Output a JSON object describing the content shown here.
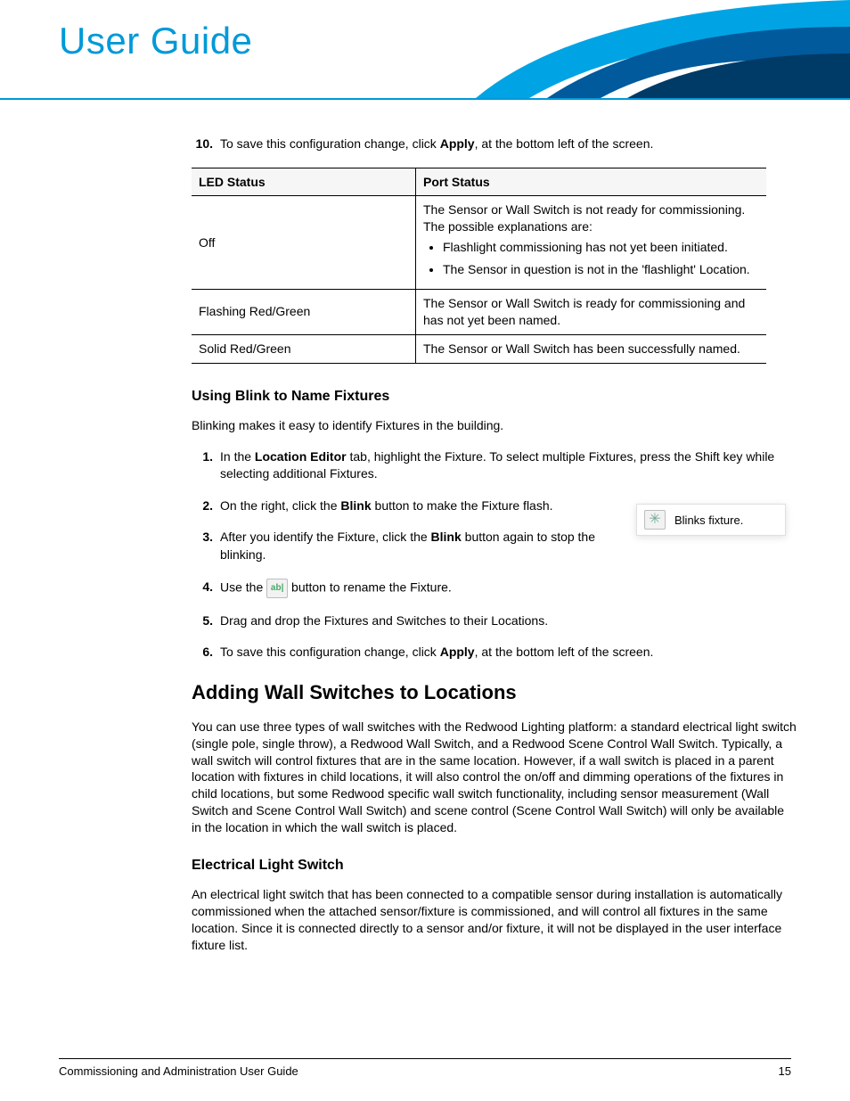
{
  "header": {
    "title": "User Guide"
  },
  "intro_step": {
    "num": "10.",
    "pre": "To save this configuration change, click ",
    "bold": "Apply",
    "post": ", at the bottom left of the screen."
  },
  "table": {
    "h1": "LED Status",
    "h2": "Port Status",
    "rows": [
      {
        "led": "Off",
        "lead": "The Sensor or Wall Switch is not ready for commissioning. The possible explanations are:",
        "bullets": [
          "Flashlight commissioning has not yet been initiated.",
          "The Sensor in question is not in the 'flashlight' Location."
        ]
      },
      {
        "led": "Flashing Red/Green",
        "text": "The Sensor or Wall Switch is ready for commissioning and has not yet been named."
      },
      {
        "led": "Solid Red/Green",
        "text": "The Sensor or Wall Switch has been successfully named."
      }
    ]
  },
  "sec1": {
    "title": "Using Blink to Name Fixtures",
    "intro": "Blinking makes it easy to identify Fixtures in the building.",
    "steps": [
      {
        "num": "1.",
        "pre": "In the ",
        "bold": "Location Editor",
        "post": " tab, highlight the Fixture. To select multiple Fixtures, press the Shift key while selecting additional Fixtures."
      },
      {
        "num": "2.",
        "pre": "On the right, click the ",
        "bold": "Blink",
        "post": " button to make the Fixture flash."
      },
      {
        "num": "3.",
        "pre": "After you identify the Fixture, click the ",
        "bold": "Blink",
        "post": " button again to stop the blinking."
      },
      {
        "num": "4.",
        "pre": "Use the  ",
        "post": "  button to rename the Fixture."
      },
      {
        "num": "5.",
        "text": "Drag and drop the Fixtures and Switches to their Locations."
      },
      {
        "num": "6.",
        "pre": "To save this configuration change, click ",
        "bold": "Apply",
        "post": ", at the bottom left of the screen."
      }
    ]
  },
  "callout": {
    "text": "Blinks fixture."
  },
  "sec2": {
    "title": "Adding Wall Switches to Locations",
    "body": "You can use three types of wall switches with the Redwood Lighting platform: a standard electrical light switch (single pole, single throw), a Redwood Wall Switch, and a Redwood Scene Control Wall Switch. Typically, a wall switch will control fixtures that are in the same location. However, if a wall switch is placed in a parent location with fixtures in child locations, it will also control the on/off and dimming operations of the fixtures in child locations, but some Redwood specific wall switch functionality, including sensor measurement (Wall Switch and Scene Control Wall Switch) and scene control (Scene Control Wall Switch) will only be available in the location in which the wall switch is placed."
  },
  "sec3": {
    "title": "Electrical Light Switch",
    "body": "An electrical light switch that has been connected to a compatible sensor during installation is automatically commissioned when the attached sensor/fixture is commissioned, and will control all fixtures in the same location. Since it is connected directly to a sensor and/or fixture, it will not be displayed in the user interface fixture list."
  },
  "footer": {
    "left": "Commissioning and Administration User Guide",
    "right": "15"
  }
}
